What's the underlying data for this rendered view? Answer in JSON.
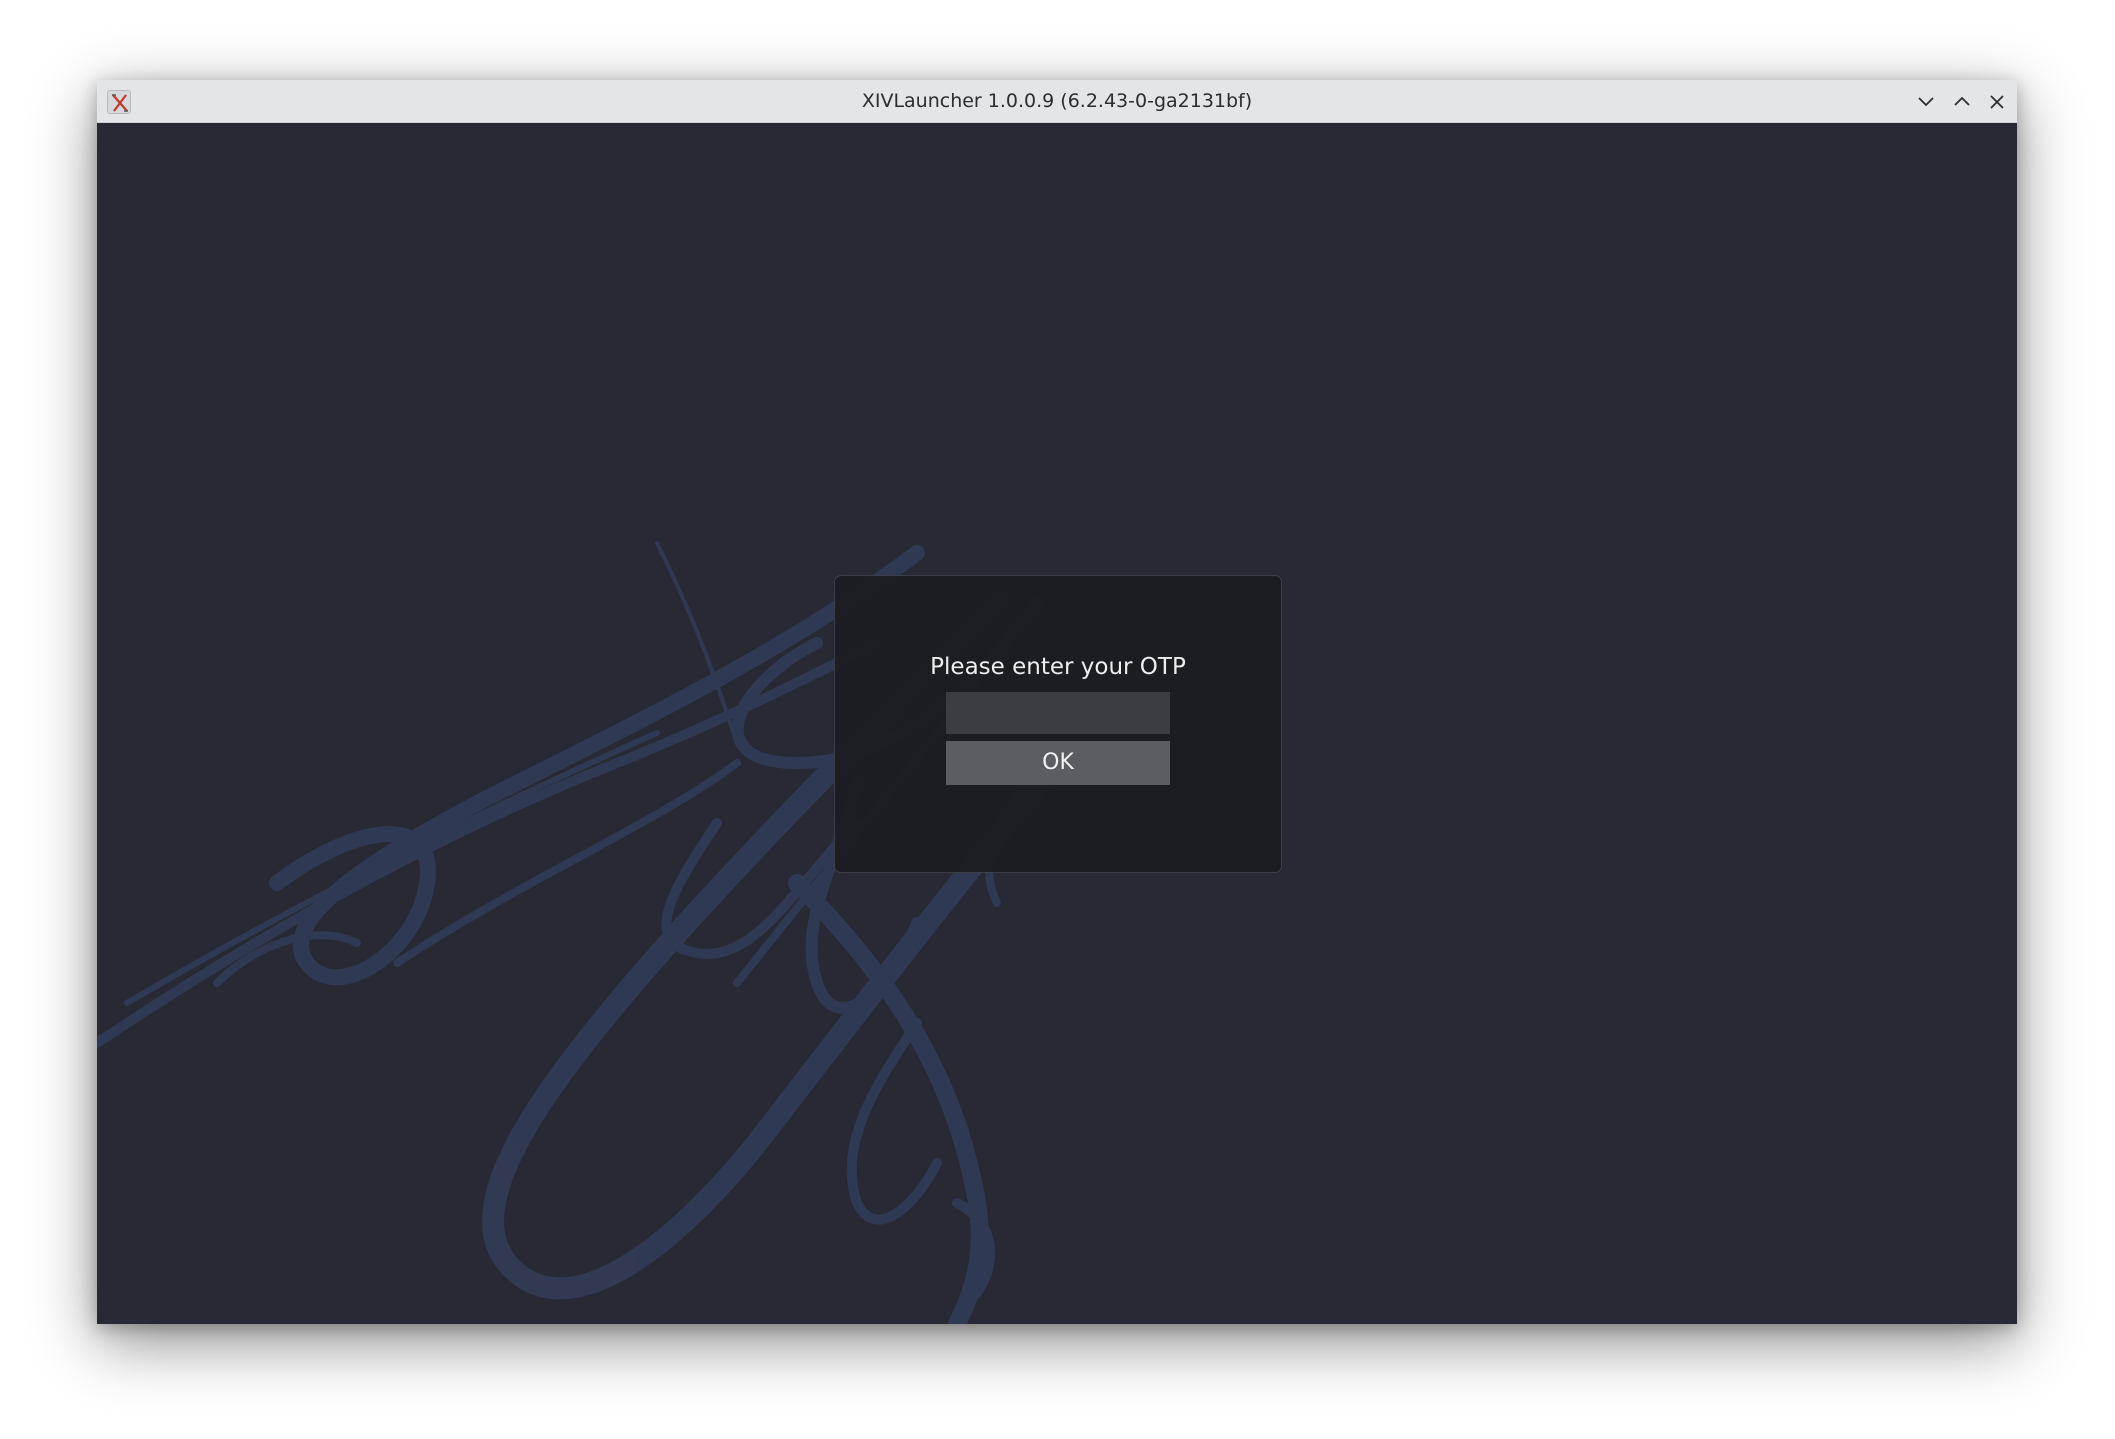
{
  "window": {
    "title": "XIVLauncher 1.0.0.9 (6.2.43-0-ga2131bf)",
    "app_icon": "xivlauncher-app-icon",
    "controls": {
      "minimize_icon": "chevron-down-icon",
      "maximize_icon": "chevron-up-icon",
      "close_icon": "close-icon"
    }
  },
  "dialog": {
    "label": "Please enter your OTP",
    "otp_value": "",
    "ok_label": "OK"
  },
  "colors": {
    "background": "#272a34",
    "dialog_bg": "#1c1d21",
    "input_bg": "#3b3d43",
    "button_bg": "#5b5d63",
    "titlebar_bg": "#e3e5e8",
    "art_color": "#34405e"
  }
}
